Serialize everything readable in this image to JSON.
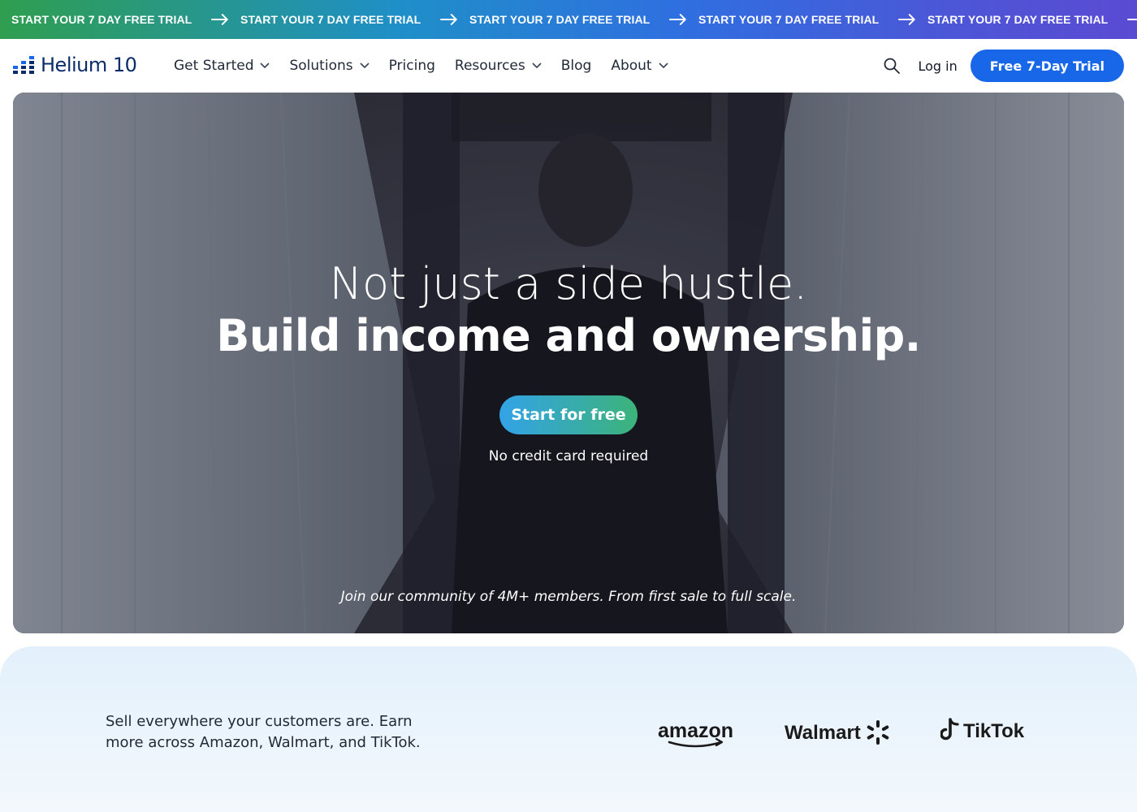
{
  "ticker": {
    "items": [
      "START YOUR 7 DAY FREE TRIAL",
      "START YOUR 7 DAY FREE TRIAL",
      "START YOUR 7 DAY FREE TRIAL",
      "START YOUR 7 DAY FREE TRIAL",
      "START YOUR 7 DAY FREE TRIAL"
    ],
    "arrow_icon": "arrow-right-icon"
  },
  "nav": {
    "logo_text": "Helium 10",
    "menu": [
      {
        "label": "Get Started",
        "dropdown": true
      },
      {
        "label": "Solutions",
        "dropdown": true
      },
      {
        "label": "Pricing",
        "dropdown": false
      },
      {
        "label": "Resources",
        "dropdown": true
      },
      {
        "label": "Blog",
        "dropdown": false
      },
      {
        "label": "About",
        "dropdown": true
      }
    ],
    "search_icon": "search-icon",
    "login_label": "Log in",
    "trial_label": "Free 7-Day Trial"
  },
  "hero": {
    "headline_line1": "Not just a side hustle.",
    "headline_line2": "Build income and ownership.",
    "cta_label": "Start for free",
    "cta_note": "No credit card required",
    "community_text": "Join our community of 4M+ members. From first sale to full scale."
  },
  "markets": {
    "copy": "Sell everywhere your customers are. Earn more across Amazon, Walmart, and TikTok.",
    "logos": [
      "amazon",
      "Walmart",
      "TikTok"
    ]
  },
  "colors": {
    "brand_blue": "#1767e8",
    "logo_navy": "#0b2c6b",
    "cta_gradient_start": "#33a3e8",
    "cta_gradient_end": "#3cb37a"
  }
}
